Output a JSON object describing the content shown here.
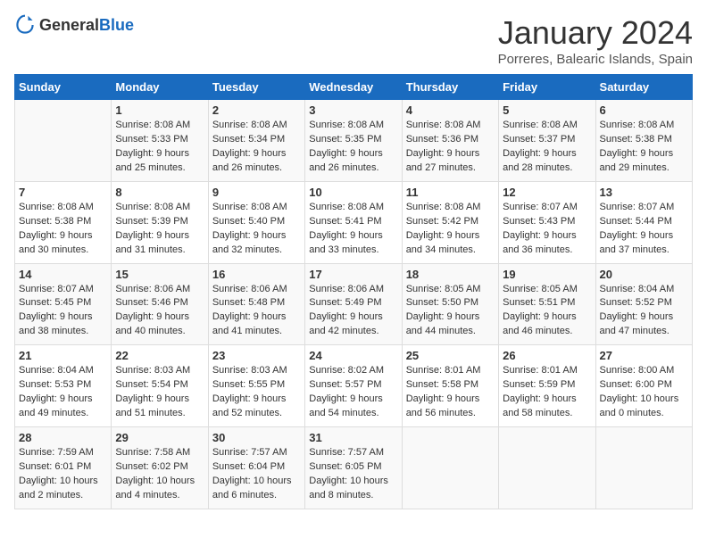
{
  "header": {
    "logo": {
      "general": "General",
      "blue": "Blue"
    },
    "title": "January 2024",
    "location": "Porreres, Balearic Islands, Spain"
  },
  "weekdays": [
    "Sunday",
    "Monday",
    "Tuesday",
    "Wednesday",
    "Thursday",
    "Friday",
    "Saturday"
  ],
  "weeks": [
    [
      {
        "day": "",
        "lines": []
      },
      {
        "day": "1",
        "lines": [
          "Sunrise: 8:08 AM",
          "Sunset: 5:33 PM",
          "Daylight: 9 hours",
          "and 25 minutes."
        ]
      },
      {
        "day": "2",
        "lines": [
          "Sunrise: 8:08 AM",
          "Sunset: 5:34 PM",
          "Daylight: 9 hours",
          "and 26 minutes."
        ]
      },
      {
        "day": "3",
        "lines": [
          "Sunrise: 8:08 AM",
          "Sunset: 5:35 PM",
          "Daylight: 9 hours",
          "and 26 minutes."
        ]
      },
      {
        "day": "4",
        "lines": [
          "Sunrise: 8:08 AM",
          "Sunset: 5:36 PM",
          "Daylight: 9 hours",
          "and 27 minutes."
        ]
      },
      {
        "day": "5",
        "lines": [
          "Sunrise: 8:08 AM",
          "Sunset: 5:37 PM",
          "Daylight: 9 hours",
          "and 28 minutes."
        ]
      },
      {
        "day": "6",
        "lines": [
          "Sunrise: 8:08 AM",
          "Sunset: 5:38 PM",
          "Daylight: 9 hours",
          "and 29 minutes."
        ]
      }
    ],
    [
      {
        "day": "7",
        "lines": [
          "Sunrise: 8:08 AM",
          "Sunset: 5:38 PM",
          "Daylight: 9 hours",
          "and 30 minutes."
        ]
      },
      {
        "day": "8",
        "lines": [
          "Sunrise: 8:08 AM",
          "Sunset: 5:39 PM",
          "Daylight: 9 hours",
          "and 31 minutes."
        ]
      },
      {
        "day": "9",
        "lines": [
          "Sunrise: 8:08 AM",
          "Sunset: 5:40 PM",
          "Daylight: 9 hours",
          "and 32 minutes."
        ]
      },
      {
        "day": "10",
        "lines": [
          "Sunrise: 8:08 AM",
          "Sunset: 5:41 PM",
          "Daylight: 9 hours",
          "and 33 minutes."
        ]
      },
      {
        "day": "11",
        "lines": [
          "Sunrise: 8:08 AM",
          "Sunset: 5:42 PM",
          "Daylight: 9 hours",
          "and 34 minutes."
        ]
      },
      {
        "day": "12",
        "lines": [
          "Sunrise: 8:07 AM",
          "Sunset: 5:43 PM",
          "Daylight: 9 hours",
          "and 36 minutes."
        ]
      },
      {
        "day": "13",
        "lines": [
          "Sunrise: 8:07 AM",
          "Sunset: 5:44 PM",
          "Daylight: 9 hours",
          "and 37 minutes."
        ]
      }
    ],
    [
      {
        "day": "14",
        "lines": [
          "Sunrise: 8:07 AM",
          "Sunset: 5:45 PM",
          "Daylight: 9 hours",
          "and 38 minutes."
        ]
      },
      {
        "day": "15",
        "lines": [
          "Sunrise: 8:06 AM",
          "Sunset: 5:46 PM",
          "Daylight: 9 hours",
          "and 40 minutes."
        ]
      },
      {
        "day": "16",
        "lines": [
          "Sunrise: 8:06 AM",
          "Sunset: 5:48 PM",
          "Daylight: 9 hours",
          "and 41 minutes."
        ]
      },
      {
        "day": "17",
        "lines": [
          "Sunrise: 8:06 AM",
          "Sunset: 5:49 PM",
          "Daylight: 9 hours",
          "and 42 minutes."
        ]
      },
      {
        "day": "18",
        "lines": [
          "Sunrise: 8:05 AM",
          "Sunset: 5:50 PM",
          "Daylight: 9 hours",
          "and 44 minutes."
        ]
      },
      {
        "day": "19",
        "lines": [
          "Sunrise: 8:05 AM",
          "Sunset: 5:51 PM",
          "Daylight: 9 hours",
          "and 46 minutes."
        ]
      },
      {
        "day": "20",
        "lines": [
          "Sunrise: 8:04 AM",
          "Sunset: 5:52 PM",
          "Daylight: 9 hours",
          "and 47 minutes."
        ]
      }
    ],
    [
      {
        "day": "21",
        "lines": [
          "Sunrise: 8:04 AM",
          "Sunset: 5:53 PM",
          "Daylight: 9 hours",
          "and 49 minutes."
        ]
      },
      {
        "day": "22",
        "lines": [
          "Sunrise: 8:03 AM",
          "Sunset: 5:54 PM",
          "Daylight: 9 hours",
          "and 51 minutes."
        ]
      },
      {
        "day": "23",
        "lines": [
          "Sunrise: 8:03 AM",
          "Sunset: 5:55 PM",
          "Daylight: 9 hours",
          "and 52 minutes."
        ]
      },
      {
        "day": "24",
        "lines": [
          "Sunrise: 8:02 AM",
          "Sunset: 5:57 PM",
          "Daylight: 9 hours",
          "and 54 minutes."
        ]
      },
      {
        "day": "25",
        "lines": [
          "Sunrise: 8:01 AM",
          "Sunset: 5:58 PM",
          "Daylight: 9 hours",
          "and 56 minutes."
        ]
      },
      {
        "day": "26",
        "lines": [
          "Sunrise: 8:01 AM",
          "Sunset: 5:59 PM",
          "Daylight: 9 hours",
          "and 58 minutes."
        ]
      },
      {
        "day": "27",
        "lines": [
          "Sunrise: 8:00 AM",
          "Sunset: 6:00 PM",
          "Daylight: 10 hours",
          "and 0 minutes."
        ]
      }
    ],
    [
      {
        "day": "28",
        "lines": [
          "Sunrise: 7:59 AM",
          "Sunset: 6:01 PM",
          "Daylight: 10 hours",
          "and 2 minutes."
        ]
      },
      {
        "day": "29",
        "lines": [
          "Sunrise: 7:58 AM",
          "Sunset: 6:02 PM",
          "Daylight: 10 hours",
          "and 4 minutes."
        ]
      },
      {
        "day": "30",
        "lines": [
          "Sunrise: 7:57 AM",
          "Sunset: 6:04 PM",
          "Daylight: 10 hours",
          "and 6 minutes."
        ]
      },
      {
        "day": "31",
        "lines": [
          "Sunrise: 7:57 AM",
          "Sunset: 6:05 PM",
          "Daylight: 10 hours",
          "and 8 minutes."
        ]
      },
      {
        "day": "",
        "lines": []
      },
      {
        "day": "",
        "lines": []
      },
      {
        "day": "",
        "lines": []
      }
    ]
  ]
}
